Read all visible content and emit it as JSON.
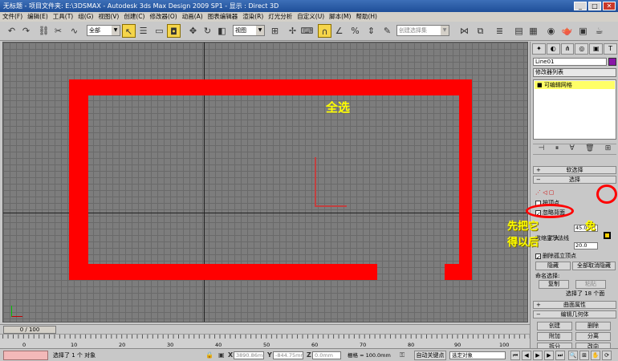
{
  "window": {
    "title": "无标题    - 项目文件夹: E:\\3DSMAX    - Autodesk 3ds Max Design 2009 SP1        - 显示 : Direct 3D",
    "minimize_glyph": "_",
    "maximize_glyph": "□",
    "close_glyph": "✕"
  },
  "menu": {
    "items": [
      "文件(F)",
      "编辑(E)",
      "工具(T)",
      "组(G)",
      "视图(V)",
      "创建(C)",
      "修改器(O)",
      "动画(A)",
      "图表编辑器",
      "渲染(R)",
      "灯光分析",
      "自定义(U)",
      "脚本(M)",
      "帮助(H)"
    ]
  },
  "toolbar": {
    "filter_value": "全部",
    "ref_coord_value": "视图",
    "named_selection_placeholder": "创建选择集"
  },
  "viewport": {
    "label": "全选",
    "shape_color": "#ff0000",
    "label_color": "#ffff00"
  },
  "command_panel": {
    "object_name": "Line01",
    "object_color": "#8a16a6",
    "modifier_list_label": "修改器列表",
    "stack_item": "可编辑网格",
    "rollouts": {
      "soft_selection": "软选择",
      "selection": "选择",
      "surface_properties": "曲面属性",
      "edit_geometry": "编辑几何体"
    },
    "selection": {
      "by_vertex": "按顶点",
      "ignore_backfacing": "忽略背面",
      "by_angle_value": "45.0",
      "shrink": "收缩",
      "grow": "扩大",
      "planar_threshold_value": "20.0",
      "show_normals": "显示法线",
      "delete_isolated": "删除孤立顶点",
      "hide": "隐藏",
      "unhide_all": "全部取消隐藏",
      "named_selections": "命名选择:",
      "copy": "复制",
      "paste": "粘贴",
      "status": "选择了 18 个面"
    },
    "edit_geometry": {
      "create": "创建",
      "delete": "删除",
      "attach": "附加",
      "detach": "分离",
      "divide": "拆分",
      "turn": "改向"
    }
  },
  "overlay_text": {
    "line1": "先把它",
    "line1_end": "免",
    "line2": "得以后"
  },
  "timeline": {
    "frame_display": "0 / 100",
    "ticks": [
      "0",
      "10",
      "20",
      "30",
      "40",
      "50",
      "60",
      "70",
      "80",
      "90",
      "100"
    ]
  },
  "status": {
    "selection_text": "选择了 1 个 对象",
    "x_value": "3890.86mm",
    "y_value": "-844.75mm",
    "z_value": "0.0mm",
    "grid_value": "栅格 = 100.0mm",
    "auto_key": "自动关键点",
    "selected_object": "选定对象"
  }
}
